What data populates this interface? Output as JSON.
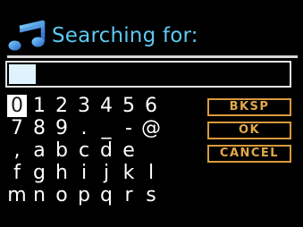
{
  "header": {
    "icon": "music-note-icon",
    "title": "Searching for:",
    "title_color": "#5ec8f0"
  },
  "search": {
    "value": ""
  },
  "keypad": {
    "selected_key": "0",
    "rows": [
      [
        "0",
        "1",
        "2",
        "3",
        "4",
        "5",
        "6"
      ],
      [
        "7",
        "8",
        "9",
        ".",
        "_",
        "-",
        "@"
      ],
      [
        ",",
        "a",
        "b",
        "c",
        "d",
        "e"
      ],
      [
        "f",
        "g",
        "h",
        "i",
        "j",
        "k",
        "l"
      ],
      [
        "m",
        "n",
        "o",
        "p",
        "q",
        "r",
        "s"
      ]
    ]
  },
  "actions": {
    "backspace": "BKSP",
    "ok": "OK",
    "cancel": "CANCEL"
  },
  "colors": {
    "background": "#000000",
    "key_text": "#ffffff",
    "button_border": "#d99a3c",
    "button_text": "#e3a84a"
  }
}
